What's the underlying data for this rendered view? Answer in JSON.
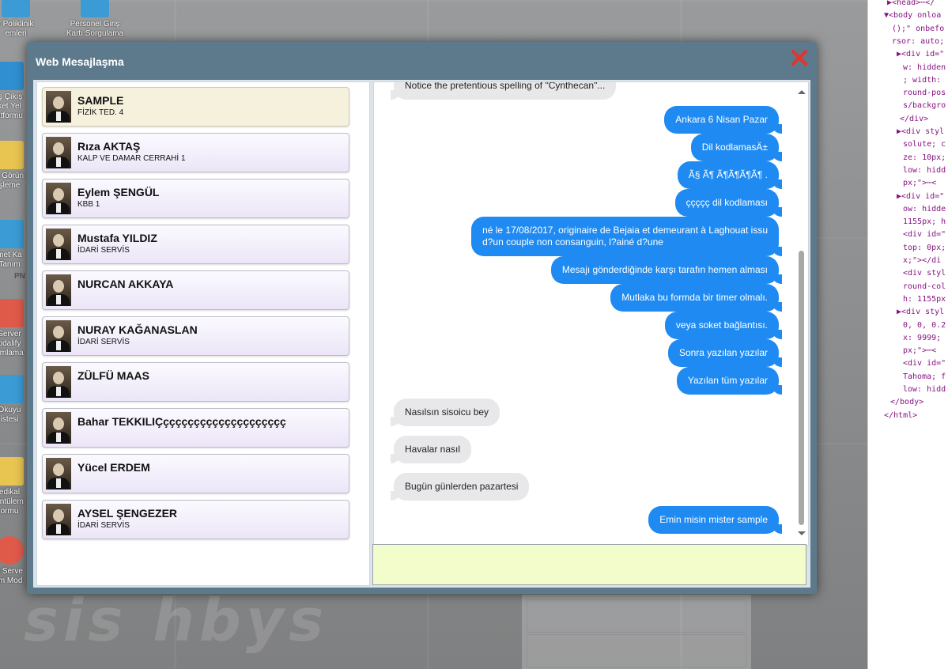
{
  "desktop": {
    "icons": [
      {
        "label": "r Poliklinik\nemleri"
      },
      {
        "label": "Personel Giriş\nKartı Sorgulama"
      },
      {
        "label": "iş Çıkış\nket Yel\natformu"
      },
      {
        "label": "a Görün\nşleme"
      },
      {
        "label": "met Ka\nTanım"
      },
      {
        "label": "PN"
      },
      {
        "label": "Server\nodalify\numlama"
      },
      {
        "label": "Okuyu\nistesi"
      },
      {
        "label": "edikal\nüntülem\normu"
      },
      {
        "label": "s Serve\nim Mod"
      }
    ],
    "watermark": "sis hbys"
  },
  "dialog": {
    "title": "Web Mesajlaşma",
    "close_icon": "close-x-icon",
    "accent": "#e8322a"
  },
  "contacts": [
    {
      "name": "SAMPLE",
      "dept": "FİZİK TED. 4",
      "active": true
    },
    {
      "name": "Rıza AKTAŞ",
      "dept": "KALP VE DAMAR CERRAHİ 1"
    },
    {
      "name": "Eylem ŞENGÜL",
      "dept": "KBB 1"
    },
    {
      "name": "Mustafa YILDIZ",
      "dept": "İDARİ SERVİS"
    },
    {
      "name": "NURCAN AKKAYA",
      "dept": ""
    },
    {
      "name": "NURAY KAĞANASLAN",
      "dept": "İDARİ SERVİS"
    },
    {
      "name": "ZÜLFÜ MAAS",
      "dept": ""
    },
    {
      "name": "Bahar TEKKILIÇçççççççççççççççççççç",
      "dept": ""
    },
    {
      "name": "Yücel ERDEM",
      "dept": ""
    },
    {
      "name": "AYSEL ŞENGEZER",
      "dept": "İDARİ SERVİS"
    }
  ],
  "messages": [
    {
      "dir": "in",
      "text": "Notice the pretentious spelling of \"Cynthecan\"..."
    },
    {
      "dir": "out",
      "text": "Ankara 6 Nisan Pazar"
    },
    {
      "dir": "out",
      "text": "Dil kodlamasÄ±"
    },
    {
      "dir": "out",
      "text": "Ã§ Ã¶ Ã¶Ã¶Ã¶Ã¶ ."
    },
    {
      "dir": "out",
      "text": "ççççç dil kodlaması"
    },
    {
      "dir": "out",
      "text": "né le 17/08/2017, originaire de Bejaia et demeurant à Laghouat issu",
      "text2": "d?un couple non consanguin, l?ainé d?une"
    },
    {
      "dir": "out",
      "text": "Mesajı gönderdiğinde karşı tarafın hemen alması"
    },
    {
      "dir": "out",
      "text": "Mutlaka bu formda bir timer olmalı."
    },
    {
      "dir": "out",
      "text": "veya soket bağlantısı."
    },
    {
      "dir": "out",
      "text": "Sonra yazılan yazılar"
    },
    {
      "dir": "out",
      "text": "Yazılan tüm yazılar"
    },
    {
      "dir": "in",
      "text": "Nasılsın sisoicu bey"
    },
    {
      "dir": "in",
      "text": "Havalar nasıl"
    },
    {
      "dir": "in",
      "text": "Bugün günlerden pazartesi"
    },
    {
      "dir": "out",
      "text": "Emin misin mister sample"
    }
  ],
  "compose": {
    "value": "",
    "placeholder": ""
  },
  "devtools": {
    "lines": [
      "▶<head>⋯</",
      "▼<body onloa",
      "();\" onbefo",
      "rsor: auto;",
      "▶<div id=\"",
      "w: hidden",
      "; width:",
      "round-pos",
      "s/backgro",
      "</div>",
      "▶<div styl",
      "solute; c",
      "ze: 10px;",
      "low: hidd",
      "px;\">⋯<",
      "▶<div id=\"",
      "ow: hidde",
      "1155px; h",
      "<div id=\"",
      "top: 0px;",
      "x;\"></di",
      "<div styl",
      "round-col",
      "h: 1155px",
      "▶<div styl",
      "0, 0, 0.2",
      "x: 9999;",
      "px;\">⋯<",
      "<div id=\"",
      "Tahoma; f",
      "low: hidd",
      "</body>",
      "</html>"
    ]
  }
}
